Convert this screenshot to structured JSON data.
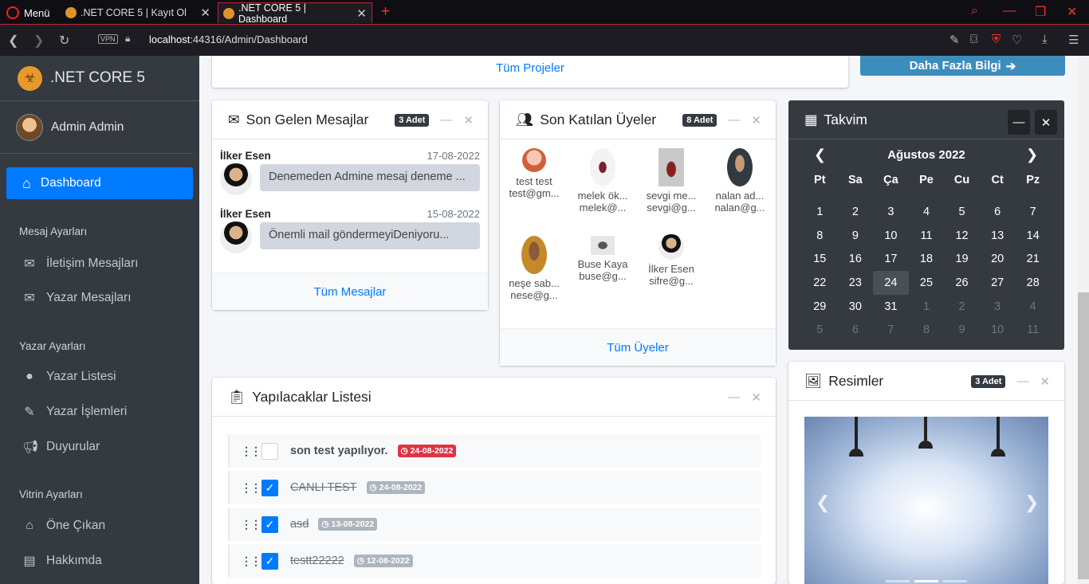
{
  "browser": {
    "menu_label": "Menü",
    "tabs": [
      {
        "title": ".NET CORE 5 | Kayıt Ol"
      },
      {
        "title": ".NET CORE 5 | Dashboard"
      }
    ],
    "vpn": "VPN",
    "url_host": "localhost",
    "url_rest": ":44316/Admin/Dashboard"
  },
  "sidebar": {
    "brand": ".NET CORE 5",
    "user": "Admin Admin",
    "active_item": "Dashboard",
    "sections": [
      {
        "header": "Mesaj Ayarları",
        "items": [
          "İletişim Mesajları",
          "Yazar Mesajları"
        ]
      },
      {
        "header": "Yazar Ayarları",
        "items": [
          "Yazar Listesi",
          "Yazar İşlemleri",
          "Duyurular"
        ]
      },
      {
        "header": "Vitrin Ayarları",
        "items": [
          "Öne Çıkan",
          "Hakkımda"
        ]
      }
    ]
  },
  "top": {
    "all_projects": "Tüm Projeler",
    "more_info": "Daha Fazla Bilgi"
  },
  "messages": {
    "title": "Son Gelen Mesajlar",
    "badge": "3 Adet",
    "items": [
      {
        "name": "İlker Esen",
        "date": "17-08-2022",
        "text": "Denemeden Admine mesaj deneme ..."
      },
      {
        "name": "İlker Esen",
        "date": "15-08-2022",
        "text": "Önemli mail göndermeyiDeniyoru..."
      }
    ],
    "footer": "Tüm Mesajlar"
  },
  "members": {
    "title": "Son Katılan Üyeler",
    "badge": "8 Adet",
    "items": [
      {
        "name": "test test",
        "email": "test@gm..."
      },
      {
        "name": "melek ök...",
        "email": "melek@..."
      },
      {
        "name": "sevgi me...",
        "email": "sevgi@g..."
      },
      {
        "name": "nalan ad...",
        "email": "nalan@g..."
      },
      {
        "name": "neşe sab...",
        "email": "nese@g..."
      },
      {
        "name": "Buse Kaya",
        "email": "buse@g..."
      },
      {
        "name": "İlker Esen",
        "email": "sifre@g..."
      }
    ],
    "footer": "Tüm Üyeler"
  },
  "calendar": {
    "title": "Takvim",
    "month": "Ağustos 2022",
    "weekdays": [
      "Pt",
      "Sa",
      "Ça",
      "Pe",
      "Cu",
      "Ct",
      "Pz"
    ],
    "days": [
      "1",
      "2",
      "3",
      "4",
      "5",
      "6",
      "7",
      "8",
      "9",
      "10",
      "11",
      "12",
      "13",
      "14",
      "15",
      "16",
      "17",
      "18",
      "19",
      "20",
      "21",
      "22",
      "23",
      "24",
      "25",
      "26",
      "27",
      "28",
      "29",
      "30",
      "31",
      "1",
      "2",
      "3",
      "4",
      "5",
      "6",
      "7",
      "8",
      "9",
      "10",
      "11"
    ],
    "today": "24"
  },
  "todo": {
    "title": "Yapılacaklar Listesi",
    "items": [
      {
        "text": "son test yapılıyor.",
        "date": "24-08-2022",
        "done": false
      },
      {
        "text": "CANLI TEST",
        "date": "24-08-2022",
        "done": true
      },
      {
        "text": "asd",
        "date": "13-08-2022",
        "done": true
      },
      {
        "text": "testt22222",
        "date": "12-08-2022",
        "done": true
      }
    ]
  },
  "images": {
    "title": "Resimler",
    "badge": "3 Adet"
  },
  "colors": {
    "primary": "#007bff",
    "sidebar": "#343a40",
    "danger": "#dc3545",
    "info_button": "#17a2b8"
  }
}
